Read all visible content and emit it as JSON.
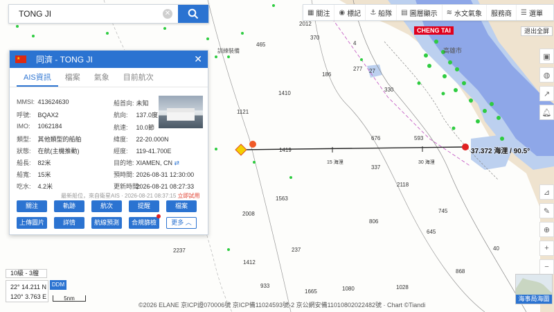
{
  "search": {
    "value": "TONG JI"
  },
  "toolbar": {
    "items": [
      "關注",
      "標記",
      "船隊",
      "圖層顯示",
      "水文氣象",
      "服務商",
      "選單"
    ]
  },
  "logout_label": "退出全屏",
  "map_labels": {
    "place_town": "高雄市",
    "port": "CHENG TAI",
    "track_label": "37.372 海浬 / 90.5°",
    "dist_15": "15 海浬",
    "dist_30": "30 海浬",
    "training": "訓練裝備",
    "depths": [
      "2012",
      "370",
      "4",
      "465",
      "277",
      "186",
      "1410",
      "1121",
      "27",
      "330",
      "1419",
      "676",
      "593",
      "337",
      "2118",
      "1563",
      "2008",
      "806",
      "745",
      "645",
      "237",
      "1412",
      "2237",
      "1665",
      "1080",
      "868",
      "933",
      "1028",
      "40"
    ]
  },
  "panel": {
    "flag": "CN",
    "title": "同濟 - TONG JI",
    "tabs": [
      "AIS資訊",
      "檔案",
      "氣象",
      "目前航次"
    ],
    "left": [
      {
        "k": "MMSI:",
        "v": "413624630"
      },
      {
        "k": "呼號:",
        "v": "BQAX2"
      },
      {
        "k": "IMO:",
        "v": "1062184"
      },
      {
        "k": "類型:",
        "v": "其他類型的船舶"
      },
      {
        "k": "狀態:",
        "v": "在航(主機推動)"
      },
      {
        "k": "船長:",
        "v": "82米"
      },
      {
        "k": "船寬:",
        "v": "15米"
      },
      {
        "k": "吃水:",
        "v": "4.2米"
      }
    ],
    "right": [
      {
        "k": "船首向:",
        "v": "未知"
      },
      {
        "k": "航向:",
        "v": "137.0度"
      },
      {
        "k": "航速:",
        "v": "10.0節"
      },
      {
        "k": "緯度:",
        "v": "22-20.000N"
      },
      {
        "k": "經度:",
        "v": "119-41.700E"
      },
      {
        "k": "目的地:",
        "v": "XIAMEN, CN"
      },
      {
        "k": "預時間:",
        "v": "2026-08-31 12:30:00"
      },
      {
        "k": "更新時間:",
        "v": "2026-08-21 08:27:33"
      }
    ],
    "last_pos": "最新船位，來自衛星AIS · 2026-08-21 08:37:15",
    "last_pos_link": "立即試用",
    "buttons_row1": [
      "關注",
      "軌跡",
      "航次",
      "提醒",
      "檔案"
    ],
    "buttons_row2": [
      "上傳圖片",
      "詳情",
      "航線預測",
      "合規篩檢",
      "更多"
    ]
  },
  "bottom": {
    "zoom": "10級 - 3艘",
    "lat": "22° 14.211 N",
    "lon": "120° 3.763 E",
    "ddm": "DDM",
    "scale": "5nm",
    "footer": "©2026 ELANE 京ICP證070006號   京ICP備11024593號-2   京公網安備11010802022482號 · Chart ©Tiandi",
    "minimap_label": "海事局海圖"
  }
}
